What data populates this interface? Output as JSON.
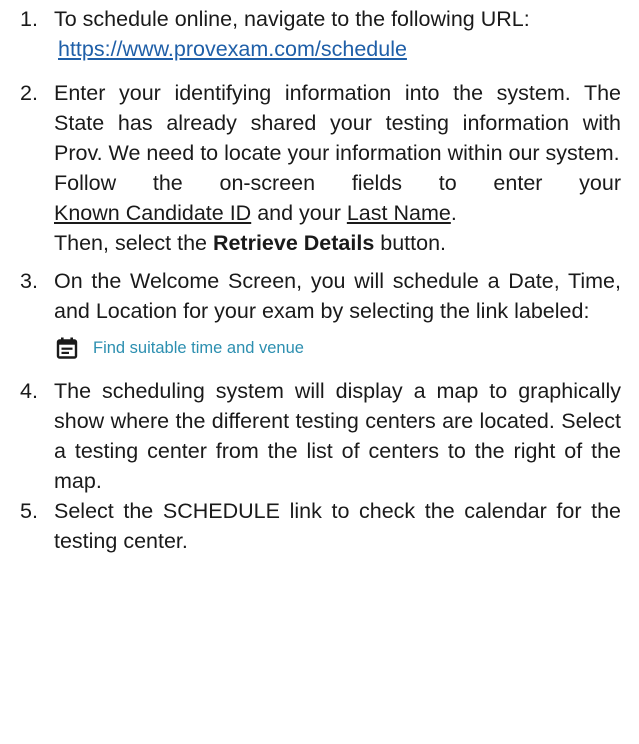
{
  "steps": [
    {
      "number": "1.",
      "text_a": "To schedule online, navigate to the following URL:",
      "link": "https://www.provexam.com/schedule"
    },
    {
      "number": "2.",
      "paragraph1": "Enter your identifying information into the system.  The State has already shared your testing information with Prov.  We need to locate your information within our system.",
      "line2_pre": "Follow the on-screen fields to enter your",
      "line3_link1": "Known Candidate ID",
      "line3_mid": " and your ",
      "line3_link2": "Last Name",
      "line3_end": ".",
      "line4_pre": "Then, select the ",
      "line4_bold": "Retrieve Details",
      "line4_end": " button."
    },
    {
      "number": "3.",
      "text": "On the Welcome Screen, you will schedule a Date, Time, and Location for your exam by selecting the link labeled:",
      "link_label": "Find suitable time and venue",
      "link_icon": "calendar-icon"
    },
    {
      "number": "4.",
      "text": "The scheduling system will display a map to graphically show where the different testing centers are located.  Select a testing center from the list of centers to the right of the map."
    },
    {
      "number": "5.",
      "text": "Select the SCHEDULE link to check the calendar for the testing center."
    }
  ],
  "colors": {
    "text": "#1a1a1a",
    "link": "#1f5fa8",
    "app_link": "#2c8fb0",
    "icon": "#1a1a1a"
  }
}
